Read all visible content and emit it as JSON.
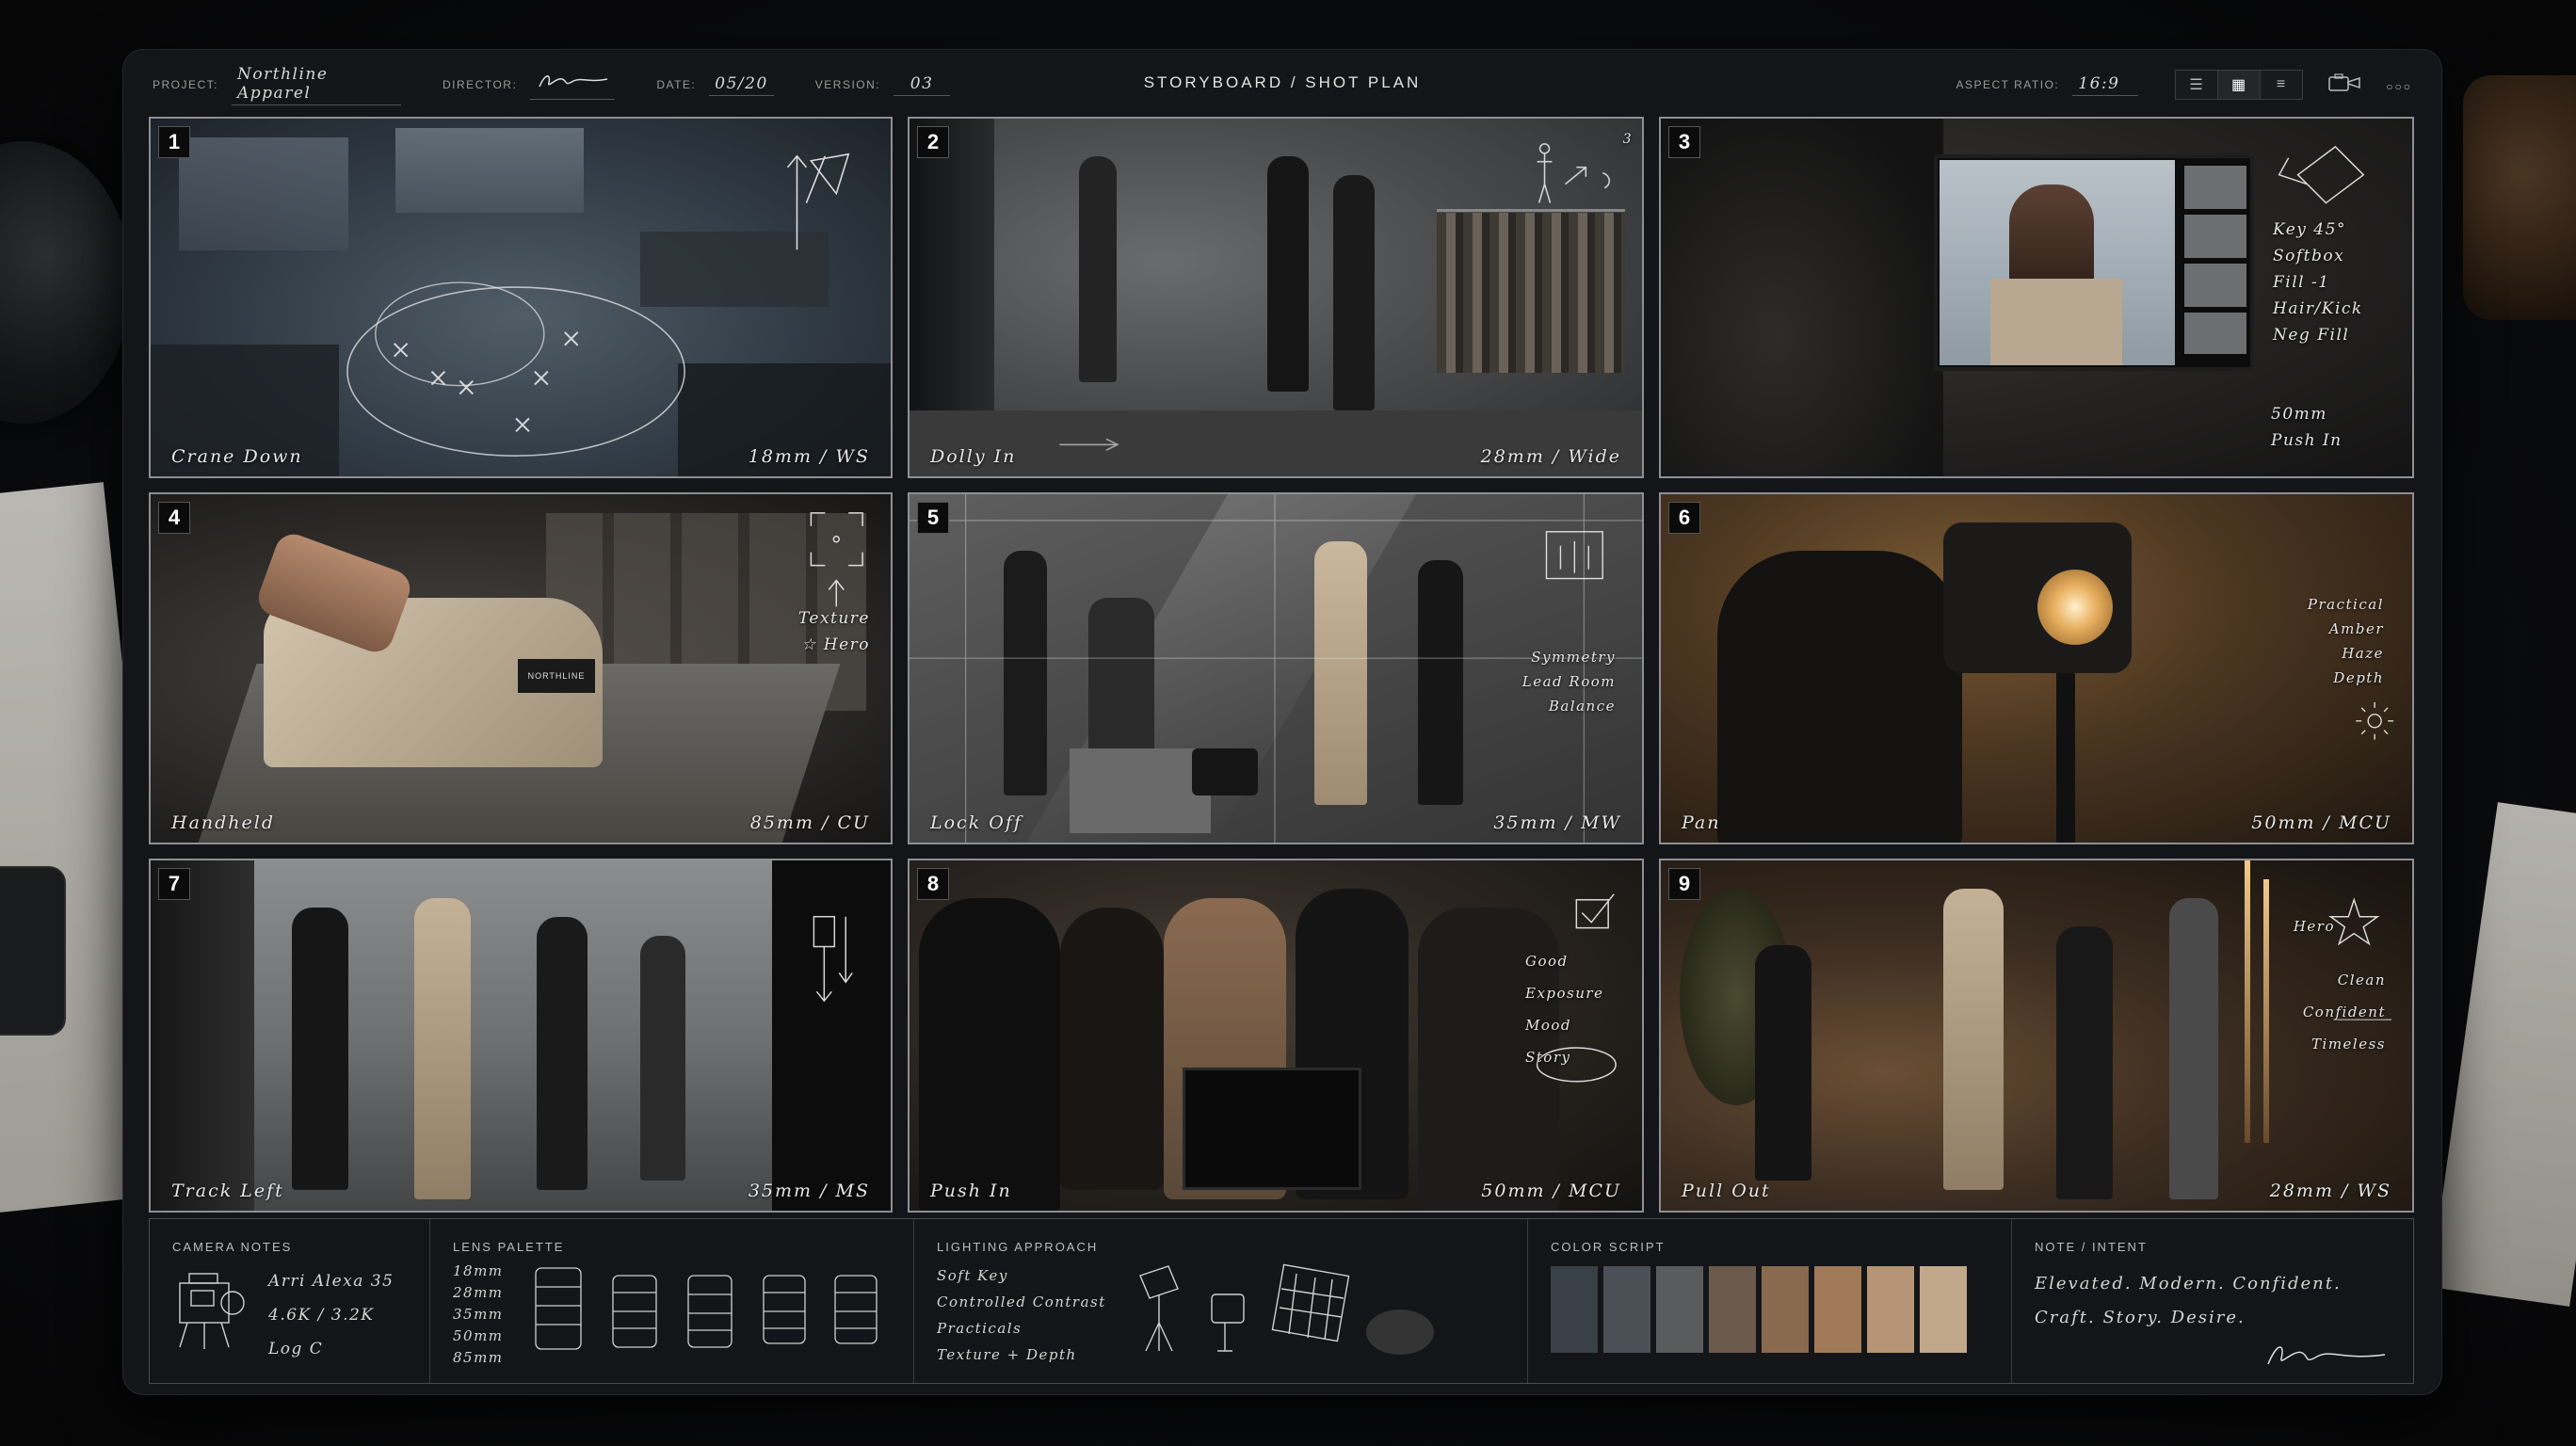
{
  "header": {
    "project_label": "PROJECT:",
    "project_value": "Northline Apparel",
    "director_label": "DIRECTOR:",
    "director_value": "signature",
    "date_label": "DATE:",
    "date_value": "05/20",
    "version_label": "VERSION:",
    "version_value": "03",
    "title": "STORYBOARD / SHOT PLAN",
    "aspect_label": "ASPECT RATIO:",
    "aspect_value": "16:9",
    "view_icons": [
      "list-view-icon",
      "grid-view-icon",
      "rows-view-icon"
    ],
    "camera_icon": "camera-icon",
    "more_icon": "more-dots-icon"
  },
  "frames": [
    {
      "number": "1",
      "movement": "Crane Down",
      "lens": "18mm / WS"
    },
    {
      "number": "2",
      "movement": "Dolly In",
      "lens": "28mm / Wide",
      "sketch_text": "3"
    },
    {
      "number": "3",
      "notes": [
        "Key 45°",
        "Softbox",
        "Fill -1",
        "Hair/Kick",
        "Neg Fill"
      ],
      "notes2": [
        "50mm",
        "Push In"
      ]
    },
    {
      "number": "4",
      "movement": "Handheld",
      "lens": "85mm / CU",
      "notes": [
        "Texture",
        "☆ Hero"
      ],
      "tag": "NORTHLINE"
    },
    {
      "number": "5",
      "movement": "Lock Off",
      "lens": "35mm / MW",
      "notes": [
        "Symmetry",
        "Lead Room",
        "Balance"
      ]
    },
    {
      "number": "6",
      "movement": "Pan",
      "lens": "50mm / MCU",
      "notes": [
        "Practical",
        "Amber",
        "Haze",
        "Depth"
      ]
    },
    {
      "number": "7",
      "movement": "Track Left",
      "lens": "35mm / MS"
    },
    {
      "number": "8",
      "movement": "Push In",
      "lens": "50mm / MCU",
      "notes": [
        "Good",
        "Exposure",
        "Mood",
        "Story"
      ]
    },
    {
      "number": "9",
      "movement": "Pull Out",
      "lens": "28mm / WS",
      "notes": [
        "Clean",
        "Confident",
        "Timeless"
      ],
      "hero": "Hero"
    }
  ],
  "camera_notes": {
    "title": "CAMERA NOTES",
    "lines": [
      "Arri Alexa 35",
      "4.6K / 3.2K",
      "Log C"
    ]
  },
  "lens_palette": {
    "title": "LENS PALETTE",
    "lenses": [
      "18mm",
      "28mm",
      "35mm",
      "50mm",
      "85mm"
    ]
  },
  "lighting": {
    "title": "LIGHTING APPROACH",
    "lines": [
      "Soft Key",
      "Controlled Contrast",
      "Practicals",
      "Texture + Depth"
    ]
  },
  "color_script": {
    "title": "COLOR SCRIPT",
    "swatches": [
      "#3a4048",
      "#4b5057",
      "#5a5b5d",
      "#6b5a4c",
      "#8a6a4e",
      "#a07a58",
      "#b59575",
      "#c2a88a"
    ]
  },
  "intent": {
    "title": "NOTE / INTENT",
    "lines": [
      "Elevated. Modern. Confident.",
      "Craft. Story. Desire."
    ]
  }
}
